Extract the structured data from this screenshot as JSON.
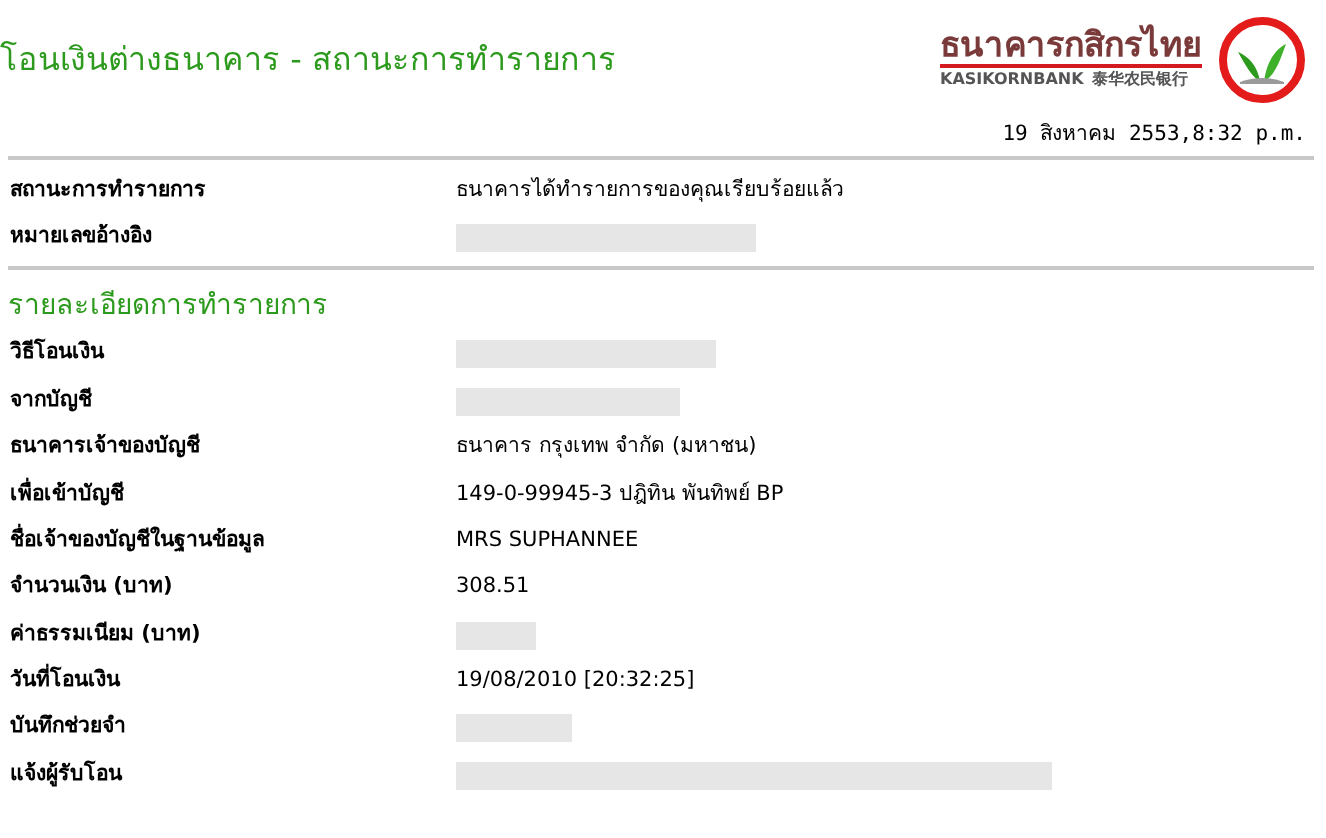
{
  "header": {
    "title": "โอนเงินต่างธนาคาร - สถานะการทำรายการ",
    "bank_name_thai": "ธนาคารกสิกรไทย",
    "bank_name_latin": "KASIKORNBANK",
    "bank_name_chinese": "泰华农民银行"
  },
  "timestamp": "19 สิงหาคม 2553,8:32 p.m.",
  "status_rows": [
    {
      "label": "สถานะการทำรายการ",
      "kind": "text",
      "value": "ธนาคารได้ทำรายการของคุณเรียบร้อยแล้ว"
    },
    {
      "label": "หมายเลขอ้างอิง",
      "kind": "redacted"
    }
  ],
  "details": {
    "heading": "รายละเอียดการทำรายการ",
    "rows": [
      {
        "label": "วิธีโอนเงิน",
        "kind": "redacted"
      },
      {
        "label": "จากบัญชี",
        "kind": "redacted"
      },
      {
        "label": "ธนาคารเจ้าของบัญชี",
        "kind": "text",
        "value": "ธนาคาร กรุงเทพ จำกัด (มหาชน)"
      },
      {
        "label": "เพื่อเข้าบัญชี",
        "kind": "text",
        "value": "149-0-99945-3 ปฎิทิน พันทิพย์ BP"
      },
      {
        "label": "ชื่อเจ้าของบัญชีในฐานข้อมูล",
        "kind": "text",
        "value": "MRS SUPHANNEE"
      },
      {
        "label": "จำนวนเงิน (บาท)",
        "kind": "text",
        "value": "308.51"
      },
      {
        "label": "ค่าธรรมเนียม (บาท)",
        "kind": "redacted"
      },
      {
        "label": "วันที่โอนเงิน",
        "kind": "text",
        "value": "19/08/2010 [20:32:25]"
      },
      {
        "label": "บันทึกช่วยจำ",
        "kind": "redacted"
      },
      {
        "label": "แจ้งผู้รับโอน",
        "kind": "redacted"
      }
    ]
  }
}
